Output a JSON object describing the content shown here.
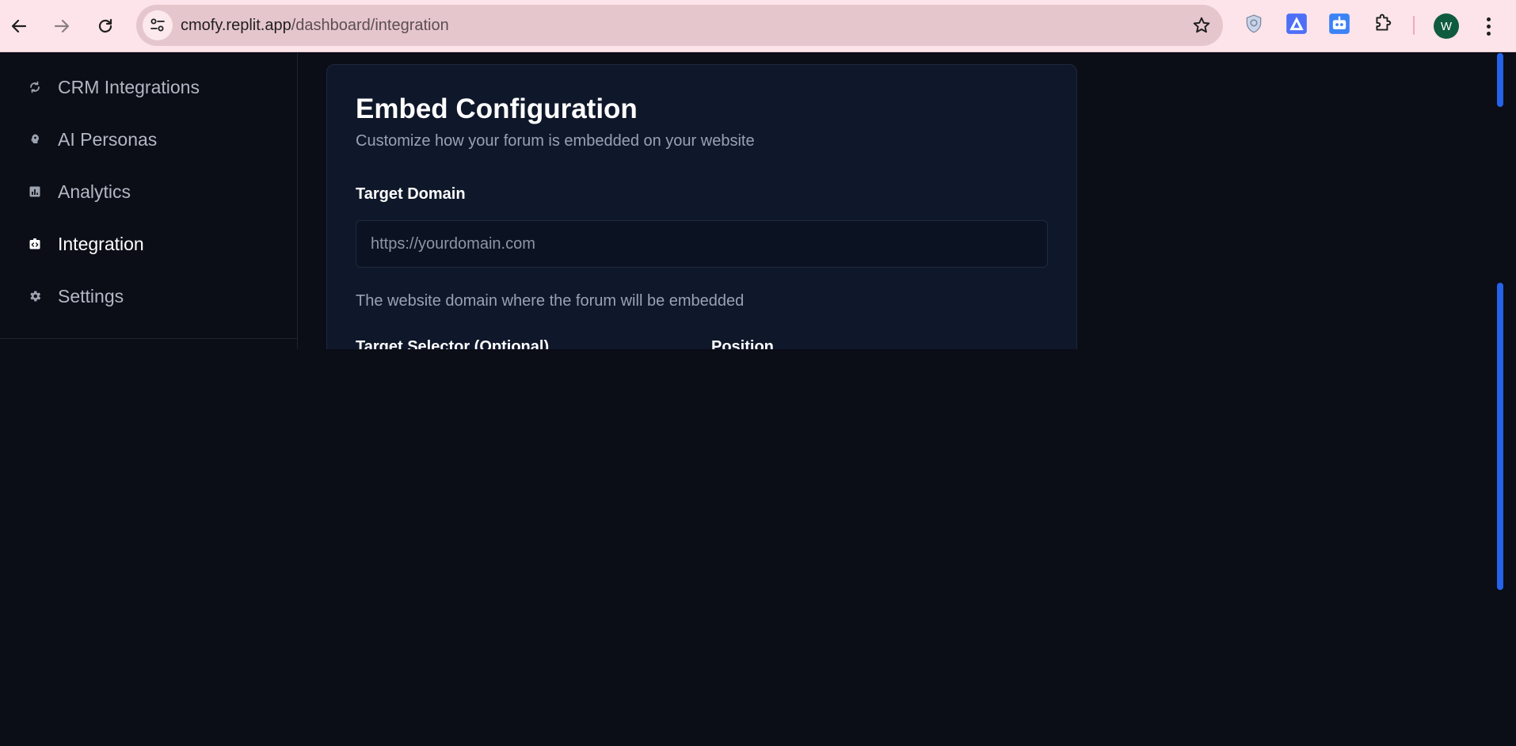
{
  "browser": {
    "url_host": "cmofy.replit.app",
    "url_path": "/dashboard/integration",
    "profile_initial": "W",
    "icons": {
      "back": "arrow-left-icon",
      "forward": "arrow-right-icon",
      "reload": "reload-icon",
      "site_info": "tune-icon",
      "bookmark": "star-icon",
      "extensions": [
        "shield-extension-icon",
        "triangle-extension-icon",
        "robot-extension-icon",
        "puzzle-icon"
      ],
      "menu": "more-vertical-icon"
    }
  },
  "sidebar": {
    "items": [
      {
        "label": "CRM Integrations",
        "icon": "sync-icon",
        "active": false
      },
      {
        "label": "AI Personas",
        "icon": "brain-icon",
        "active": false
      },
      {
        "label": "Analytics",
        "icon": "bar-chart-icon",
        "active": false
      },
      {
        "label": "Integration",
        "icon": "code-icon",
        "active": true
      },
      {
        "label": "Settings",
        "icon": "gear-icon",
        "active": false
      }
    ]
  },
  "embed_config": {
    "title": "Embed Configuration",
    "subtitle": "Customize how your forum is embedded on your website",
    "target_domain": {
      "label": "Target Domain",
      "value": "",
      "placeholder": "https://yourdomain.com",
      "help": "The website domain where the forum will be embedded"
    },
    "target_selector": {
      "label": "Target Selector (Optional)"
    },
    "position": {
      "label": "Position"
    }
  },
  "colors": {
    "chrome_bg": "#fce4ea",
    "page_bg": "#0b0d17",
    "card_bg": "#0f172a",
    "accent": "#2563eb"
  }
}
